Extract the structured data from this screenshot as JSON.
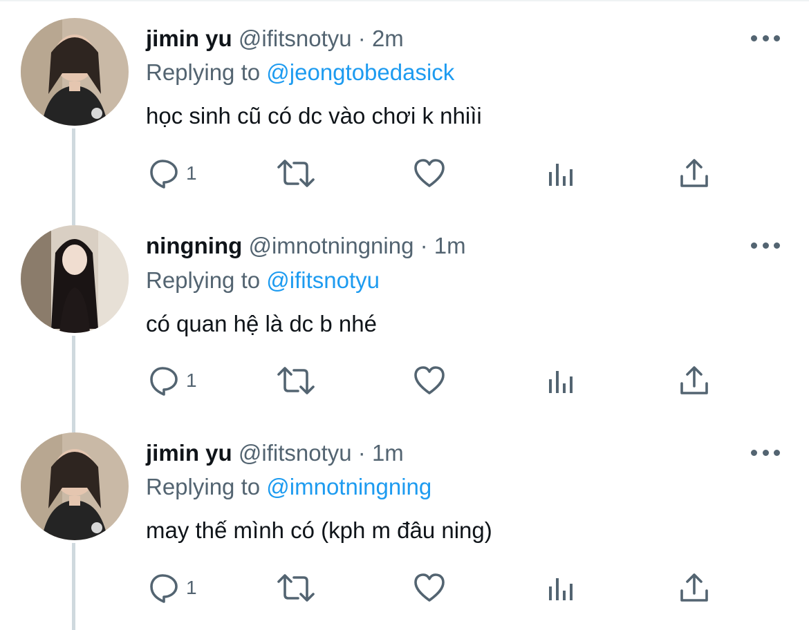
{
  "tweets": [
    {
      "name": "jimin yu",
      "handle": "@ifitsnotyu",
      "separator": "·",
      "time": "2m",
      "replying_label": "Replying to",
      "replying_to": "@jeongtobedasick",
      "text": "học sinh cũ có dc vào chơi k nhiìi",
      "reply_count": "1"
    },
    {
      "name": "ningning",
      "handle": "@imnotningning",
      "separator": "·",
      "time": "1m",
      "replying_label": "Replying to",
      "replying_to": "@ifitsnotyu",
      "text": "có quan hệ là dc b nhé",
      "reply_count": "1"
    },
    {
      "name": "jimin yu",
      "handle": "@ifitsnotyu",
      "separator": "·",
      "time": "1m",
      "replying_label": "Replying to",
      "replying_to": "@imnotningning",
      "text": "may thế mình có (kph m đâu ning)",
      "reply_count": "1"
    }
  ],
  "icons": {
    "reply": "reply-icon",
    "retweet": "retweet-icon",
    "like": "heart-icon",
    "analytics": "analytics-icon",
    "share": "share-icon",
    "more": "more-icon"
  },
  "colors": {
    "text": "#0f1419",
    "secondary": "#536471",
    "link": "#1d9bf0",
    "thread_line": "#cfd9de"
  }
}
